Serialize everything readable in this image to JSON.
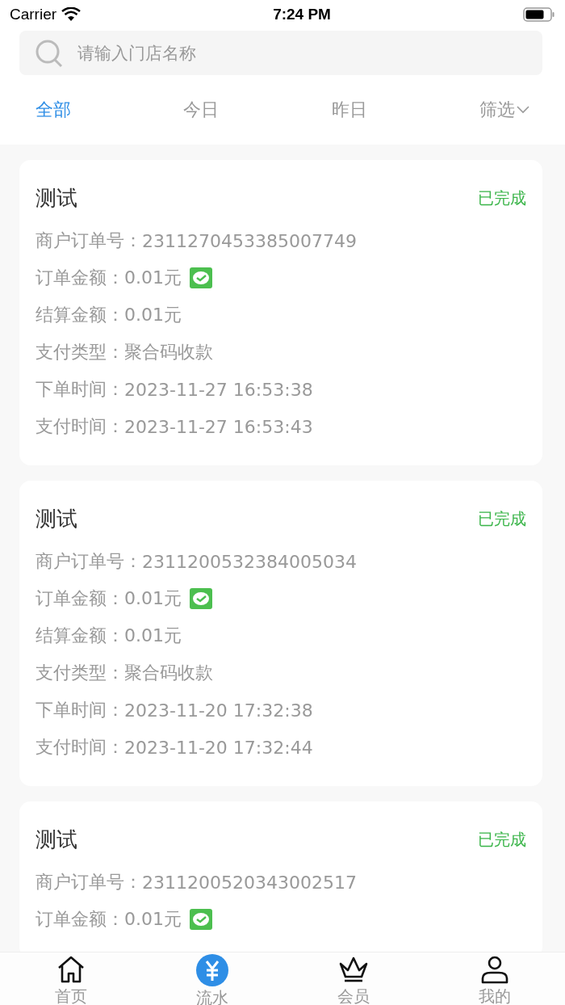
{
  "status_bar": {
    "carrier": "Carrier",
    "time": "7:24 PM"
  },
  "search": {
    "placeholder": "请输入门店名称"
  },
  "tabs": [
    {
      "label": "全部",
      "selected": true
    },
    {
      "label": "今日",
      "selected": false
    },
    {
      "label": "昨日",
      "selected": false
    },
    {
      "label": "筛选",
      "selected": false,
      "kind": "dropdown"
    }
  ],
  "orders": [
    {
      "title": "测试",
      "status": "已完成",
      "fields": [
        {
          "kind": "text",
          "label": "商户订单号：",
          "value": "2311270453385007749"
        },
        {
          "kind": "amount",
          "label": "订单金额：",
          "value": "0.01元"
        },
        {
          "kind": "text",
          "label": "结算金额：",
          "value": "0.01元"
        },
        {
          "kind": "text",
          "label": "支付类型：",
          "value": "聚合码收款"
        },
        {
          "kind": "text",
          "label": "下单时间：",
          "value": "2023-11-27 16:53:38"
        },
        {
          "kind": "text",
          "label": "支付时间：",
          "value": "2023-11-27 16:53:43"
        }
      ]
    },
    {
      "title": "测试",
      "status": "已完成",
      "fields": [
        {
          "kind": "text",
          "label": "商户订单号：",
          "value": "2311200532384005034"
        },
        {
          "kind": "amount",
          "label": "订单金额：",
          "value": "0.01元"
        },
        {
          "kind": "text",
          "label": "结算金额：",
          "value": "0.01元"
        },
        {
          "kind": "text",
          "label": "支付类型：",
          "value": "聚合码收款"
        },
        {
          "kind": "text",
          "label": "下单时间：",
          "value": "2023-11-20 17:32:38"
        },
        {
          "kind": "text",
          "label": "支付时间：",
          "value": "2023-11-20 17:32:44"
        }
      ]
    },
    {
      "title": "测试",
      "status": "已完成",
      "fields": [
        {
          "kind": "text",
          "label": "商户订单号：",
          "value": "2311200520343002517"
        },
        {
          "kind": "amount",
          "label": "订单金额：",
          "value": "0.01元"
        }
      ]
    }
  ],
  "nav": [
    {
      "label": "首页",
      "kind": "home",
      "selected": false
    },
    {
      "label": "流水",
      "kind": "yuan",
      "selected": true
    },
    {
      "label": "会员",
      "kind": "crown",
      "selected": false
    },
    {
      "label": "我的",
      "kind": "person",
      "selected": false
    }
  ]
}
